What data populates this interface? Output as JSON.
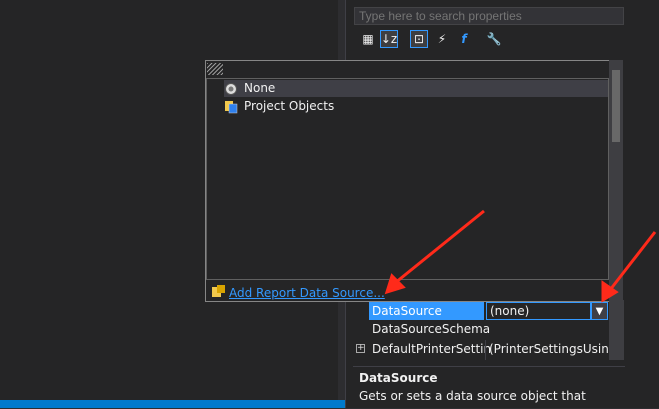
{
  "search": {
    "placeholder": "Type here to search properties"
  },
  "toolbar": {
    "items": [
      {
        "icon": "categorized-icon",
        "glyph": "▦"
      },
      {
        "icon": "alphabetical-icon",
        "glyph": "↓z"
      },
      {
        "icon": "properties-icon",
        "glyph": "⊡"
      },
      {
        "icon": "events-icon",
        "glyph": "⚡"
      },
      {
        "icon": "function-icon",
        "glyph": "f"
      },
      {
        "icon": "wrench-icon",
        "glyph": "🔧"
      }
    ]
  },
  "popup": {
    "tree": [
      {
        "label": "None",
        "icon": "none-icon"
      },
      {
        "label": "Project Objects",
        "icon": "project-objects-icon"
      }
    ],
    "add_link": "Add Report Data Source..."
  },
  "property_grid": {
    "rows": [
      {
        "name": "DataSource",
        "value": "(none)"
      },
      {
        "name": "DataSourceSchema",
        "value": ""
      },
      {
        "name": "DefaultPrinterSettin",
        "value": "(PrinterSettingsUsing"
      }
    ]
  },
  "description": {
    "title": "DataSource",
    "text": "Gets or sets a data source object that"
  },
  "colors": {
    "accent": "#3399ff",
    "arrow": "#ff2a1a",
    "status": "#007acc"
  }
}
